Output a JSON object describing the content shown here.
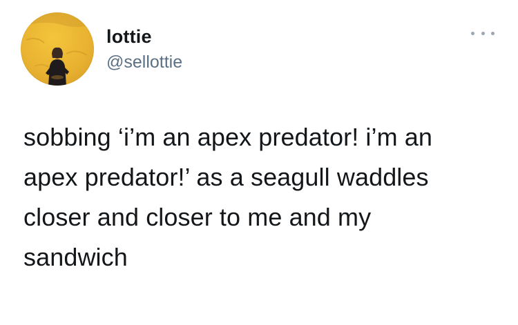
{
  "user": {
    "display_name": "lottie",
    "handle": "@sellottie"
  },
  "tweet": {
    "lines": [
      "sobbing ‘i’m an apex predator! i’m an",
      "apex predator!’ as a seagull waddles",
      "closer and closer to me and my",
      "sandwich"
    ]
  },
  "icons": {
    "more": "more-horizontal-icon"
  },
  "colors": {
    "text": "#14171a",
    "secondary": "#5b7083",
    "avatar_background": "#e9b331"
  }
}
